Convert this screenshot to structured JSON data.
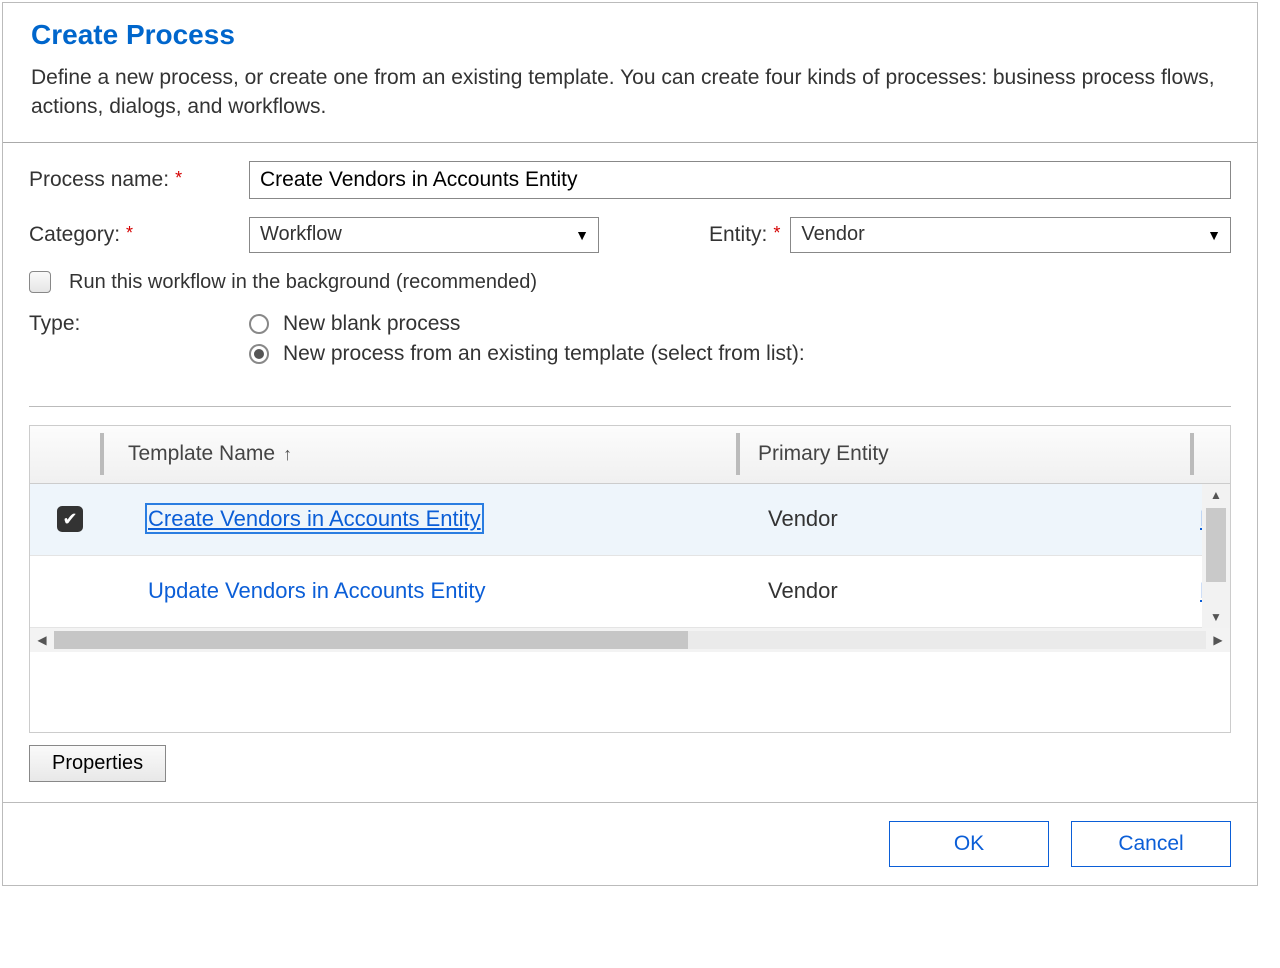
{
  "dialog": {
    "title": "Create Process",
    "subtitle": "Define a new process, or create one from an existing template. You can create four kinds of processes: business process flows, actions, dialogs, and workflows."
  },
  "form": {
    "process_name_label": "Process name:",
    "process_name_value": "Create Vendors in Accounts Entity",
    "category_label": "Category:",
    "category_value": "Workflow",
    "entity_label": "Entity:",
    "entity_value": "Vendor",
    "run_background_label": "Run this workflow in the background (recommended)",
    "run_background_checked": false,
    "type_label": "Type:",
    "type_options": {
      "blank": "New blank process",
      "template": "New process from an existing template (select from list):"
    },
    "type_selected": "template"
  },
  "grid": {
    "columns": {
      "template_name": "Template Name",
      "primary_entity": "Primary Entity"
    },
    "rows": [
      {
        "checked": true,
        "template_name": "Create Vendors in Accounts Entity",
        "primary_entity": "Vendor",
        "owner_prefix": "Bi"
      },
      {
        "checked": false,
        "template_name": "Update Vendors in Accounts Entity",
        "primary_entity": "Vendor",
        "owner_prefix": "Bi"
      }
    ]
  },
  "buttons": {
    "properties": "Properties",
    "ok": "OK",
    "cancel": "Cancel"
  }
}
